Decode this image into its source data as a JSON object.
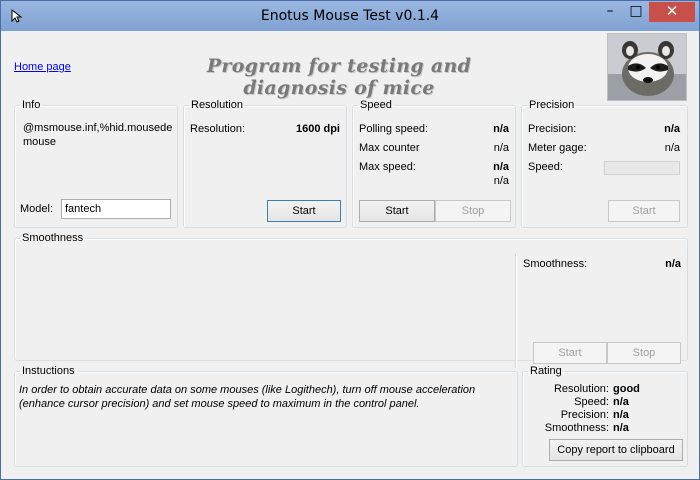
{
  "window": {
    "title": "Enotus Mouse Test v0.1.4",
    "controls": {
      "minimize": "–",
      "maximize": "□",
      "close": "✕"
    }
  },
  "header": {
    "home_link": "Home page",
    "banner": "Program for testing and diagnosis of mice",
    "photo_icon": "raccoon-photo"
  },
  "info": {
    "legend": "Info",
    "device_id": "@msmouse.inf,%hid.mousede mouse",
    "model_label": "Model:",
    "model_value": "fantech"
  },
  "resolution": {
    "legend": "Resolution",
    "label": "Resolution:",
    "value": "1600 dpi",
    "start": "Start"
  },
  "speed": {
    "legend": "Speed",
    "polling_label": "Polling speed:",
    "polling_value": "n/a",
    "max_counter_label": "Max counter",
    "max_counter_value": "n/a",
    "max_speed_label": "Max  speed:",
    "max_speed_value": "n/a",
    "max_speed_value2": "n/a",
    "start": "Start",
    "stop": "Stop"
  },
  "precision": {
    "legend": "Precision",
    "precision_label": "Precision:",
    "precision_value": "n/a",
    "meter_label": "Meter gage:",
    "meter_value": "n/a",
    "speed_label": "Speed:",
    "start": "Start"
  },
  "smoothness": {
    "legend": "Smoothness",
    "label": "Smoothness:",
    "value": "n/a",
    "start": "Start",
    "stop": "Stop"
  },
  "instructions": {
    "legend": "Instuctions",
    "text": "In order to obtain accurate data on some mouses (like Logithech), turn off mouse acceleration (enhance cursor precision) and set mouse speed to maximum in the control panel."
  },
  "rating": {
    "legend": "Rating",
    "resolution_label": "Resolution:",
    "resolution_value": "good",
    "speed_label": "Speed:",
    "speed_value": "n/a",
    "precision_label": "Precision:",
    "precision_value": "n/a",
    "smoothness_label": "Smoothness:",
    "smoothness_value": "n/a",
    "copy_button": "Copy report to clipboard"
  }
}
